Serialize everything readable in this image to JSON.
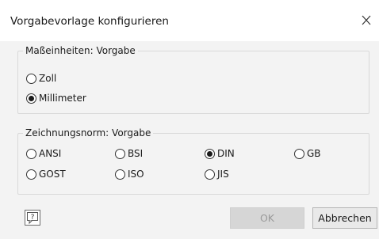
{
  "window": {
    "title": "Vorgabevorlage konfigurieren"
  },
  "units_group": {
    "legend": "Maßeinheiten: Vorgabe",
    "options": [
      {
        "label": "Zoll",
        "selected": false
      },
      {
        "label": "Millimeter",
        "selected": true
      }
    ]
  },
  "standard_group": {
    "legend": "Zeichnungsnorm: Vorgabe",
    "options": [
      {
        "label": "ANSI",
        "selected": false
      },
      {
        "label": "BSI",
        "selected": false
      },
      {
        "label": "DIN",
        "selected": true
      },
      {
        "label": "GB",
        "selected": false
      },
      {
        "label": "GOST",
        "selected": false
      },
      {
        "label": "ISO",
        "selected": false
      },
      {
        "label": "JIS",
        "selected": false
      }
    ]
  },
  "footer": {
    "ok_label": "OK",
    "ok_enabled": false,
    "cancel_label": "Abbrechen"
  },
  "icons": {
    "close": "close-icon",
    "help": "help-icon"
  }
}
